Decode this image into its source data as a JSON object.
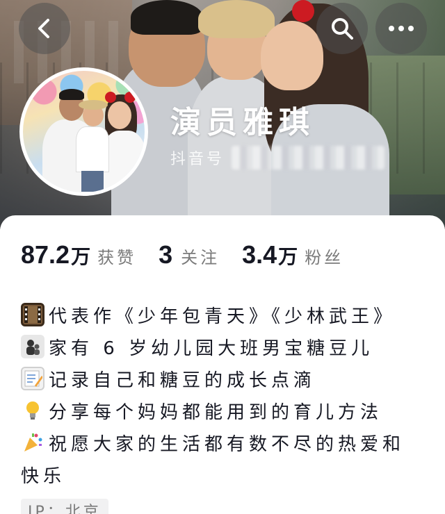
{
  "header": {
    "back_icon": "chevron-left-icon",
    "search_icon": "search-icon",
    "more_icon": "more-horizontal-icon"
  },
  "profile": {
    "nickname": "演员雅琪",
    "douyin_id_label": "抖音号"
  },
  "stats": [
    {
      "number": "87.2",
      "unit": "万",
      "label": "获赞"
    },
    {
      "number": "3",
      "unit": "",
      "label": "关注"
    },
    {
      "number": "3.4",
      "unit": "万",
      "label": "粉丝"
    }
  ],
  "bio": {
    "lines": [
      {
        "icon": "film-frames-icon",
        "text": "代表作《少年包青天》《少林武王》"
      },
      {
        "icon": "family-icon",
        "text": "家有 6 岁幼儿园大班男宝糖豆儿"
      },
      {
        "icon": "memo-icon",
        "text": "记录自己和糖豆的成长点滴"
      },
      {
        "icon": "light-bulb-icon",
        "text": "分享每个妈妈都能用到的育儿方法"
      },
      {
        "icon": "party-popper-icon",
        "text": "祝愿大家的生活都有数不尽的热爱和"
      }
    ],
    "continuation": "快乐"
  },
  "ip": {
    "text": "IP：北京"
  },
  "colors": {
    "text_primary": "#161823",
    "text_secondary": "#7a7a7a",
    "card_bg": "#ffffff",
    "tag_bg": "#f1f1f2"
  }
}
